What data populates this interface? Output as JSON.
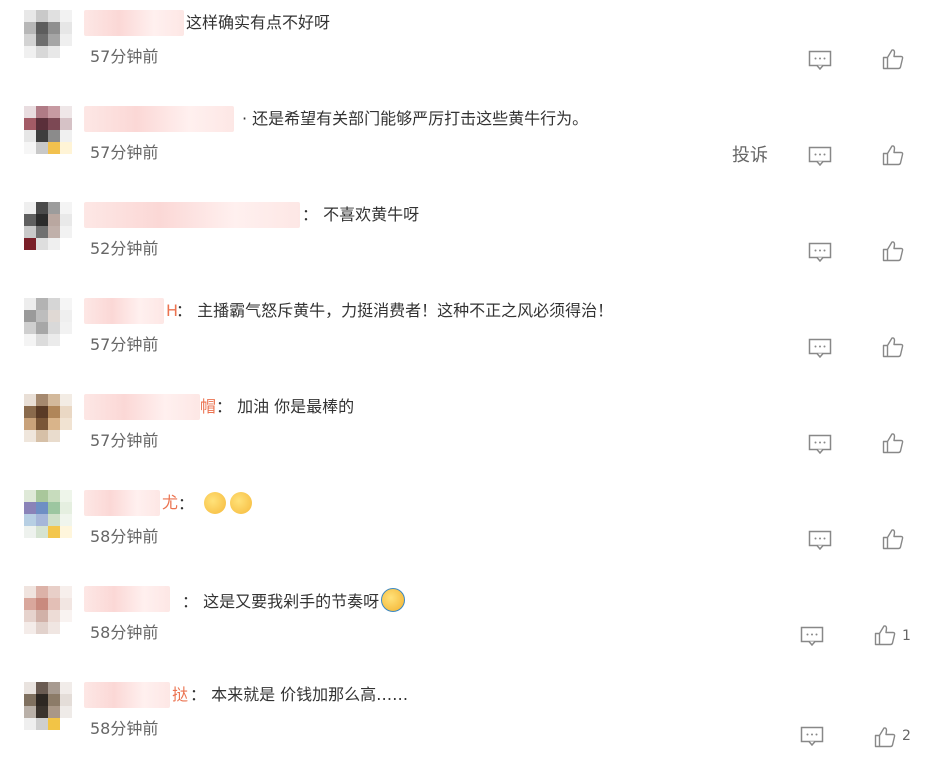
{
  "comments": [
    {
      "name_suffix": "",
      "text": "这样确实有点不好呀",
      "time": "57分钟前",
      "likes": "",
      "report": ""
    },
    {
      "name_suffix": "",
      "text": "· 还是希望有关部门能够严厉打击这些黄牛行为。",
      "time": "57分钟前",
      "likes": "",
      "report": "投诉"
    },
    {
      "name_suffix": "",
      "text": "： 不喜欢黄牛呀",
      "time": "52分钟前",
      "likes": "",
      "report": ""
    },
    {
      "name_suffix": "H",
      "text": "： 主播霸气怒斥黄牛，力挺消费者！这种不正之风必须得治！",
      "time": "57分钟前",
      "likes": "",
      "report": ""
    },
    {
      "name_suffix": "帽",
      "text": "： 加油 你是最棒的",
      "time": "57分钟前",
      "likes": "",
      "report": ""
    },
    {
      "name_suffix": "尤",
      "text": "：",
      "time": "58分钟前",
      "likes": "",
      "report": ""
    },
    {
      "name_suffix": "",
      "text": "： 这是又要我剁手的节奏呀",
      "time": "58分钟前",
      "likes": "1",
      "report": ""
    },
    {
      "name_suffix": "挞",
      "text": "： 本来就是 价钱加那么高……",
      "time": "58分钟前",
      "likes": "2",
      "report": ""
    }
  ],
  "icons": {
    "reply": "comment-icon",
    "like": "thumbs-up-icon",
    "emoji": "emoji-icon"
  },
  "colors": {
    "name_link": "#eb7350",
    "text": "#333333",
    "meta": "#666666"
  }
}
